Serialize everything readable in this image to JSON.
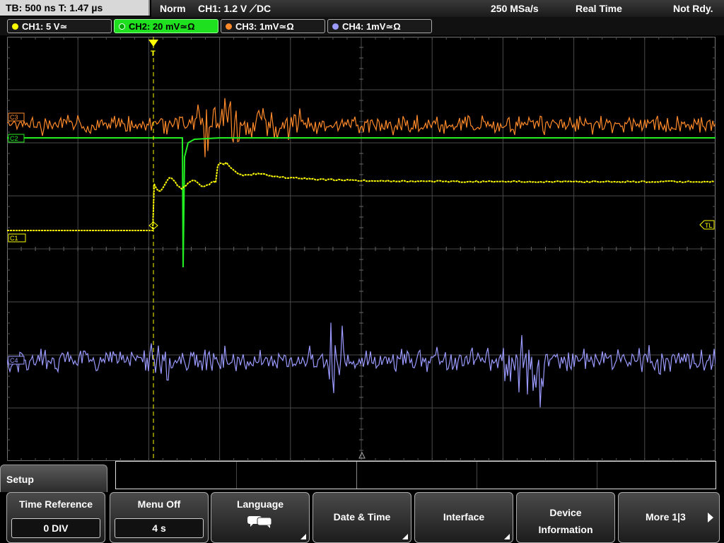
{
  "header": {
    "tb_label": "TB: 500 ns   T: 1.47 µs",
    "mode": "Norm",
    "trigger": "CH1: 1.2 V ⟋DC",
    "sample_rate": "250 MSa/s",
    "acq_mode": "Real Time",
    "status": "Not Rdy."
  },
  "channels": [
    {
      "label": "CH1: 5 V≃",
      "color": "#ffff00",
      "active": false
    },
    {
      "label": "CH2: 20 mV≃Ω",
      "color": "#22ee22",
      "active": true
    },
    {
      "label": "CH3: 1mV≃Ω",
      "color": "#ff8a2a",
      "active": false
    },
    {
      "label": "CH4: 1mV≃Ω",
      "color": "#9a9aff",
      "active": false
    }
  ],
  "markers": {
    "ch1": "C1",
    "ch2": "C2",
    "ch3": "C3",
    "ch4": "C4",
    "trigger_level": "TL",
    "trigger_pos": "T"
  },
  "colors": {
    "ch1": "#ffff00",
    "ch2": "#22ee22",
    "ch3": "#ff8a2a",
    "ch4": "#9a9aff",
    "grid": "#4a4a4a"
  },
  "menu": {
    "tab_label": "Setup",
    "time_reference": {
      "label": "Time Reference",
      "value": "0 DIV"
    },
    "menu_off": {
      "label": "Menu Off",
      "value": "4 s"
    },
    "language": {
      "label": "Language",
      "icon": "speech-bubbles-icon"
    },
    "date_time": {
      "label": "Date & Time"
    },
    "interface": {
      "label": "Interface"
    },
    "device_info": {
      "line1": "Device",
      "line2": "Information"
    },
    "more": {
      "label": "More 1|3",
      "icon": "arrow-right-icon"
    }
  }
}
